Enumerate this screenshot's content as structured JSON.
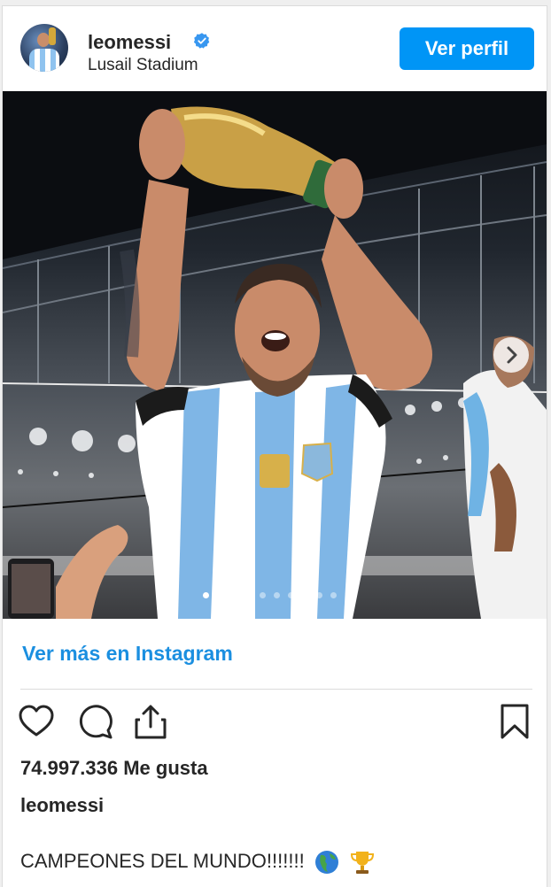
{
  "post": {
    "username": "leomessi",
    "location": "Lusail Stadium",
    "profile_button": "Ver perfil",
    "more_link": "Ver más en Instagram",
    "likes": "74.997.336 Me gusta",
    "caption_user": "leomessi",
    "caption_text": "CAMPEONES DEL MUNDO!!!!!!!",
    "caption_emojis": [
      "globe-americas-icon",
      "trophy-icon"
    ],
    "carousel": {
      "total_slides": 10,
      "active_index": 0
    }
  },
  "icons": {
    "verified": "verified-badge-icon",
    "next": "chevron-right-icon",
    "like": "heart-icon",
    "comment": "comment-icon",
    "share": "share-icon",
    "save": "bookmark-icon"
  },
  "colors": {
    "accent": "#0095f6",
    "link": "#1b8fe0",
    "text": "#262626",
    "divider": "#dbdbdb"
  }
}
